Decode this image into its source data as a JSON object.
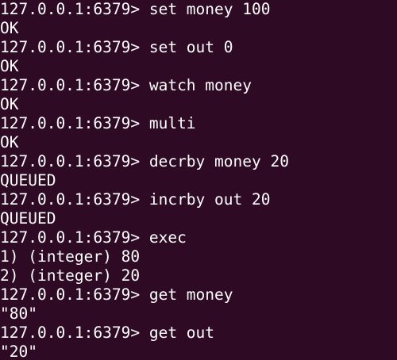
{
  "terminal": {
    "background": "#2f0a24",
    "foreground": "#ffffff",
    "lines": [
      {
        "type": "command",
        "prompt": "127.0.0.1:6379> ",
        "text": "set money 100"
      },
      {
        "type": "output",
        "text": "OK"
      },
      {
        "type": "command",
        "prompt": "127.0.0.1:6379> ",
        "text": "set out 0"
      },
      {
        "type": "output",
        "text": "OK"
      },
      {
        "type": "command",
        "prompt": "127.0.0.1:6379> ",
        "text": "watch money"
      },
      {
        "type": "output",
        "text": "OK"
      },
      {
        "type": "command",
        "prompt": "127.0.0.1:6379> ",
        "text": "multi"
      },
      {
        "type": "output",
        "text": "OK"
      },
      {
        "type": "command",
        "prompt": "127.0.0.1:6379> ",
        "text": "decrby money 20"
      },
      {
        "type": "output",
        "text": "QUEUED"
      },
      {
        "type": "command",
        "prompt": "127.0.0.1:6379> ",
        "text": "incrby out 20"
      },
      {
        "type": "output",
        "text": "QUEUED"
      },
      {
        "type": "command",
        "prompt": "127.0.0.1:6379> ",
        "text": "exec"
      },
      {
        "type": "output",
        "text": "1) (integer) 80"
      },
      {
        "type": "output",
        "text": "2) (integer) 20"
      },
      {
        "type": "command",
        "prompt": "127.0.0.1:6379> ",
        "text": "get money"
      },
      {
        "type": "output",
        "text": "\"80\""
      },
      {
        "type": "command",
        "prompt": "127.0.0.1:6379> ",
        "text": "get out"
      },
      {
        "type": "output",
        "text": "\"20\""
      }
    ]
  }
}
